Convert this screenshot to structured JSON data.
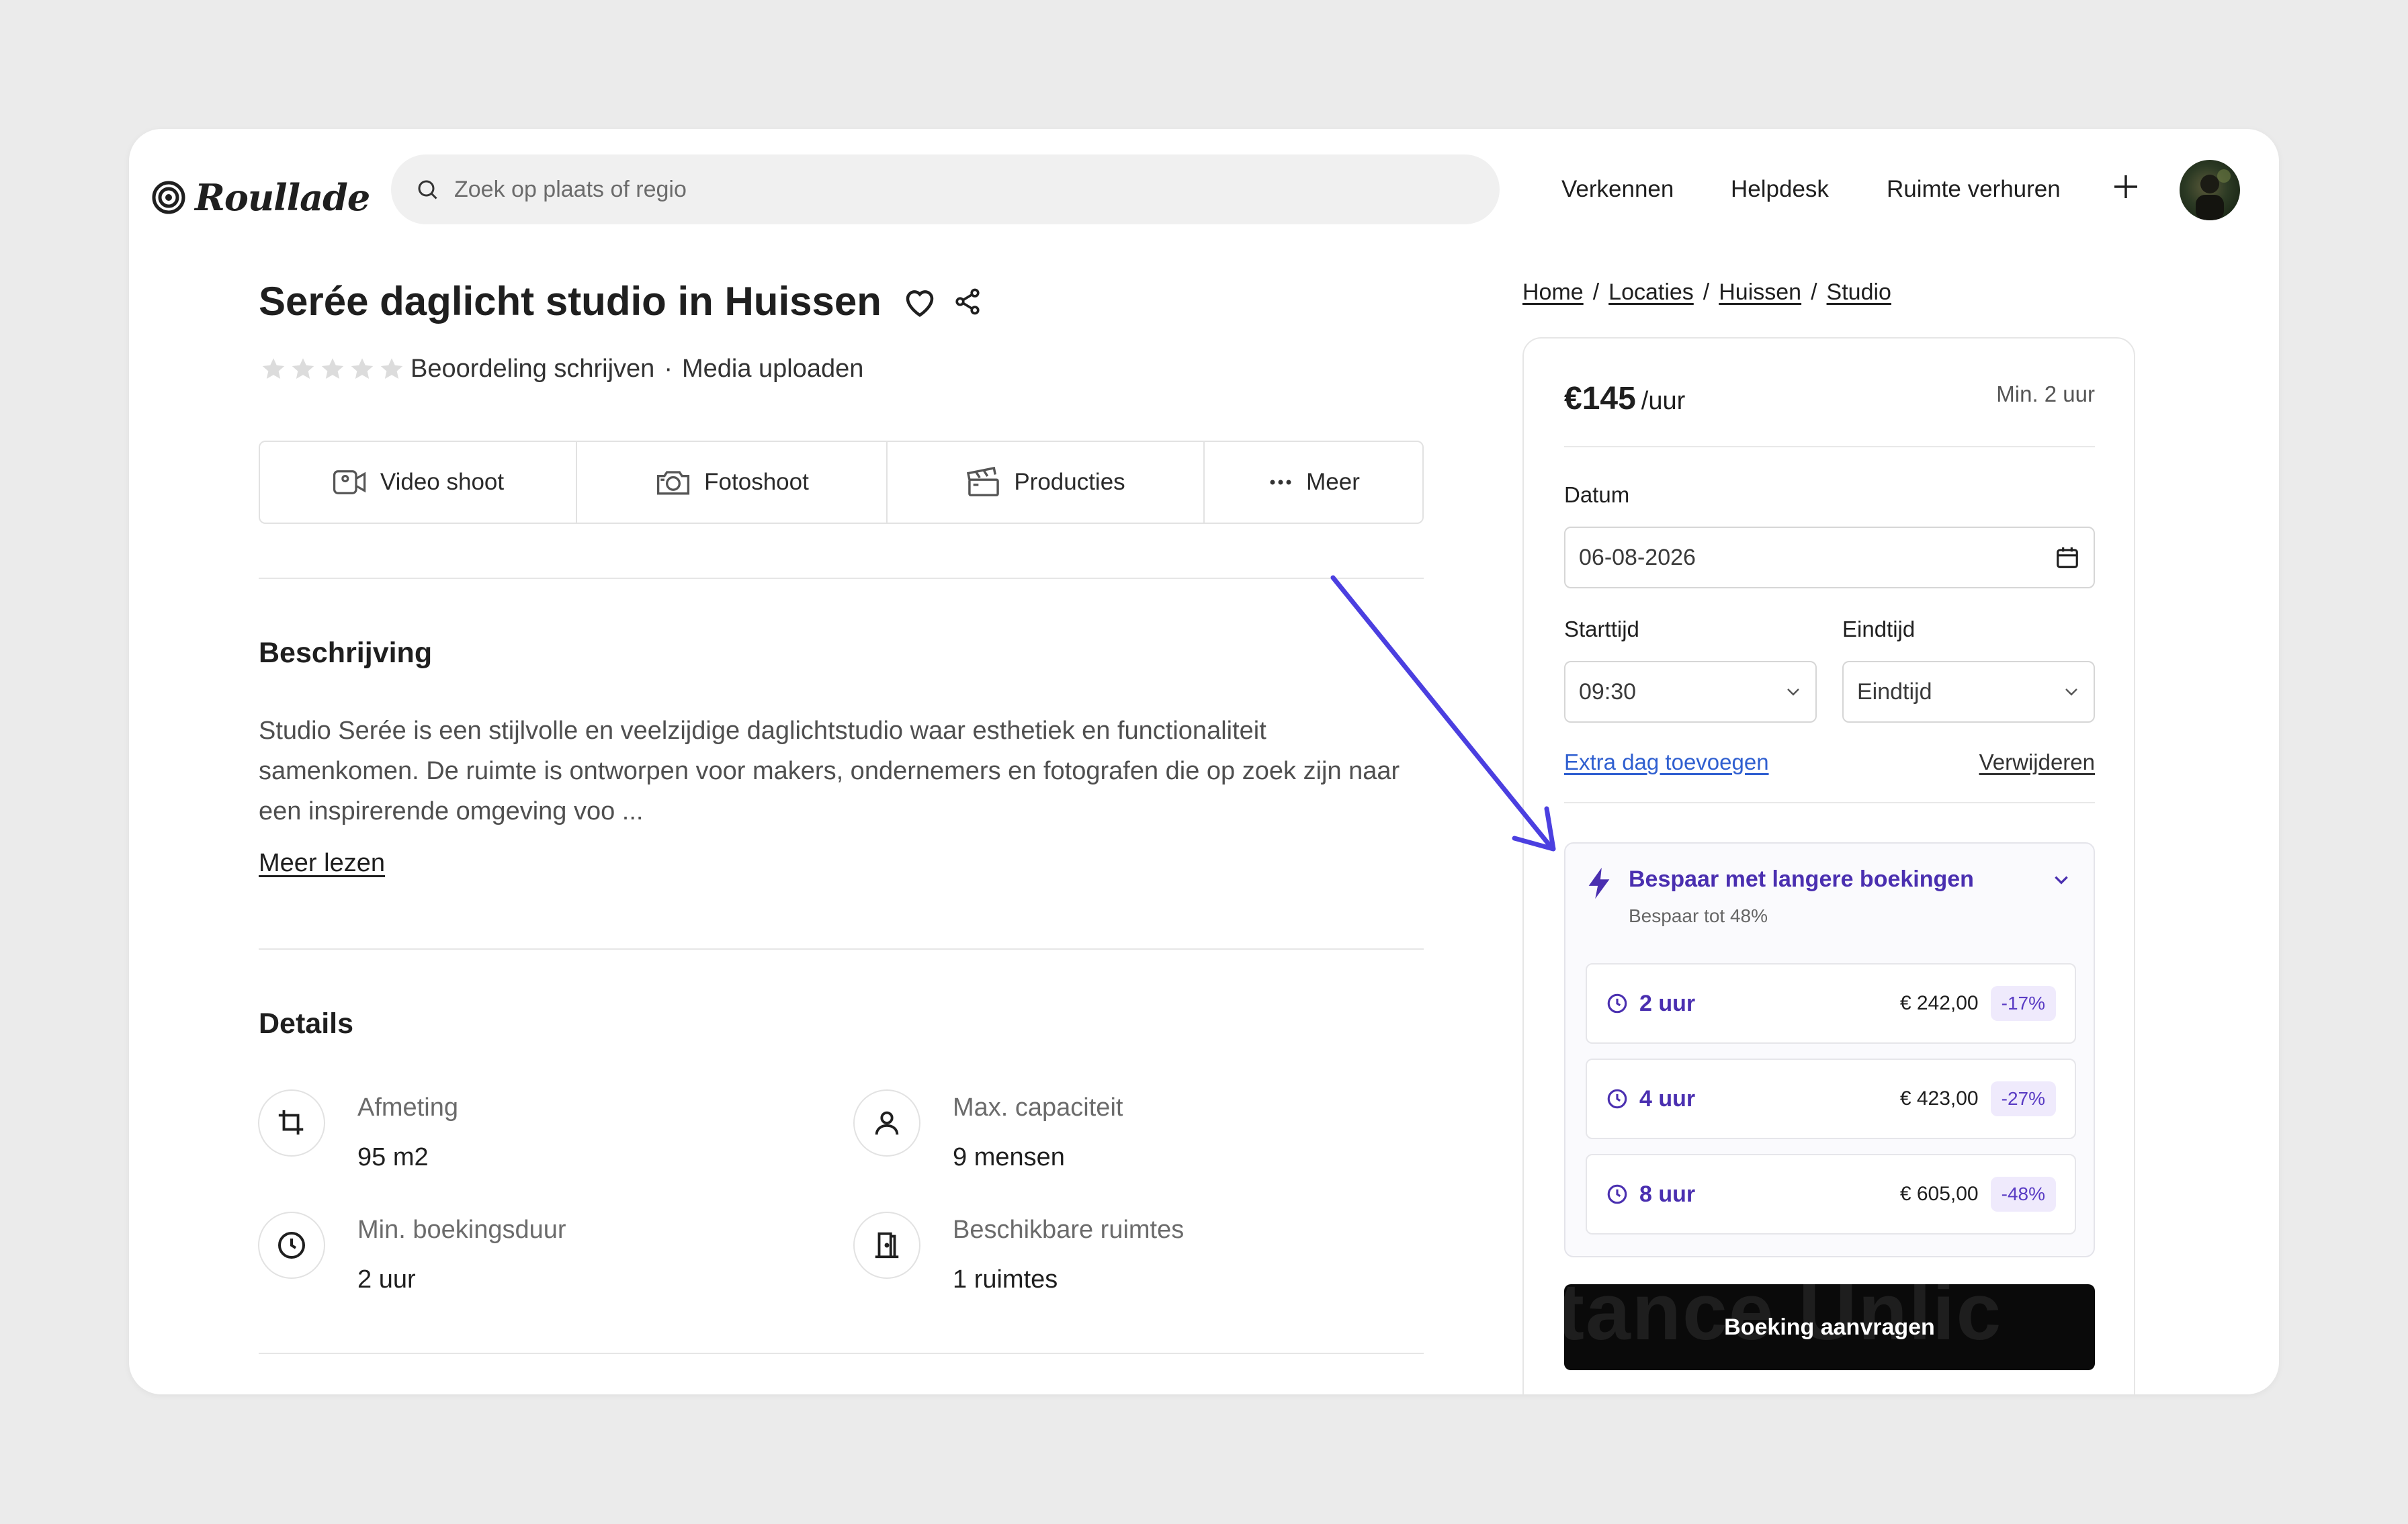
{
  "header": {
    "logo_text": "Roullade",
    "search_placeholder": "Zoek op plaats of regio",
    "nav": [
      "Verkennen",
      "Helpdesk",
      "Ruimte verhuren"
    ]
  },
  "listing": {
    "title": "Serée daglicht studio in Huissen",
    "rating": {
      "stars_filled": 0,
      "stars_total": 5,
      "write_review": "Beoordeling schrijven",
      "separator": "·",
      "upload_media": "Media uploaden"
    },
    "tabs": [
      "Video shoot",
      "Fotoshoot",
      "Producties",
      "Meer"
    ],
    "description_heading": "Beschrijving",
    "description": "Studio Serée is een stijlvolle en veelzijdige daglichtstudio waar esthetiek en functionaliteit samenkomen. De ruimte is ontworpen voor makers, ondernemers en fotografen die op zoek zijn naar een inspirerende omgeving voo ...",
    "read_more": "Meer lezen",
    "details_heading": "Details",
    "details": [
      {
        "label": "Afmeting",
        "value": "95 m2",
        "icon": "crop-icon"
      },
      {
        "label": "Max. capaciteit",
        "value": "9 mensen",
        "icon": "person-icon"
      },
      {
        "label": "Min. boekingsduur",
        "value": "2 uur",
        "icon": "clock-icon"
      },
      {
        "label": "Beschikbare ruimtes",
        "value": "1 ruimtes",
        "icon": "door-icon"
      }
    ]
  },
  "breadcrumb": [
    "Home",
    "Locaties",
    "Huissen",
    "Studio"
  ],
  "booking": {
    "price": "€145",
    "price_unit": "/uur",
    "minimum": "Min. 2 uur",
    "date_label": "Datum",
    "date_value": "06-08-2026",
    "start_label": "Starttijd",
    "start_value": "09:30",
    "end_label": "Eindtijd",
    "end_value": "Eindtijd",
    "add_day": "Extra dag toevoegen",
    "remove": "Verwijderen",
    "promo_title": "Bespaar met langere boekingen",
    "promo_sub": "Bespaar tot 48%",
    "options": [
      {
        "duration": "2 uur",
        "price": "€ 242,00",
        "discount": "-17%"
      },
      {
        "duration": "4 uur",
        "price": "€ 423,00",
        "discount": "-27%"
      },
      {
        "duration": "8 uur",
        "price": "€ 605,00",
        "discount": "-48%"
      }
    ],
    "cta": "Boeking aanvragen",
    "cta_ghost": "tance Unlic"
  },
  "colors": {
    "accent_purple": "#4a2fb0",
    "link_blue": "#2f5fd0",
    "arrow": "#4b3fe0",
    "cta_bg": "#0a0a0a"
  }
}
